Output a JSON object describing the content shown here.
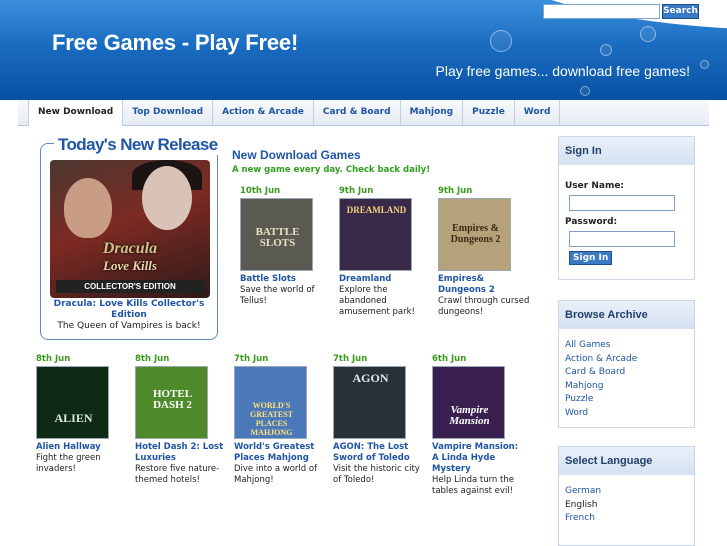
{
  "header": {
    "site_title": "Free Games - Play Free!",
    "tagline": "Play free games... download free games!",
    "search_placeholder": "",
    "search_button": "Search"
  },
  "nav": {
    "tabs": [
      {
        "label": "New Download",
        "active": true
      },
      {
        "label": "Top Download"
      },
      {
        "label": "Action & Arcade"
      },
      {
        "label": "Card & Board"
      },
      {
        "label": "Mahjong"
      },
      {
        "label": "Puzzle"
      },
      {
        "label": "Word"
      }
    ]
  },
  "release": {
    "heading": "Today's New Release",
    "art_line1": "Dracula",
    "art_line2": "Love Kills",
    "art_badge": "COLLECTOR'S EDITION",
    "title": "Dracula: Love Kills Collector's Edition",
    "description": "The Queen of Vampires is back!"
  },
  "section": {
    "title": "New Download Games",
    "subtitle": "A new game every day. Check back daily!"
  },
  "games": [
    {
      "date": "10th Jun",
      "name": "Battle Slots",
      "desc": "Save the world of Tellus!",
      "art": "BATTLE SLOTS",
      "bg": "#5b5a52"
    },
    {
      "date": "9th Jun",
      "name": "Dreamland",
      "desc": "Explore the abandoned amusement park!",
      "art": "DREAMLAND",
      "bg": "#3a2a4a"
    },
    {
      "date": "9th Jun",
      "name": "Empires& Dungeons 2",
      "desc": "Crawl through cursed dungeons!",
      "art": "Empires & Dungeons 2",
      "bg": "#b6a27a"
    },
    {
      "date": "8th Jun",
      "name": "Alien Hallway",
      "desc": "Fight the green invaders!",
      "art": "ALIEN",
      "bg": "#0f2a14"
    },
    {
      "date": "8th Jun",
      "name": "Hotel Dash 2: Lost Luxuries",
      "desc": "Restore five nature-themed hotels!",
      "art": "HOTEL DASH 2",
      "bg": "#4f8a2a"
    },
    {
      "date": "7th Jun",
      "name": "World's Greatest Places Mahjong",
      "desc": "Dive into a world of Mahjong!",
      "art": "WORLD'S GREATEST PLACES MAHJONG",
      "bg": "#4a78b8"
    },
    {
      "date": "7th Jun",
      "name": "AGON: The Lost Sword of Toledo",
      "desc": "Visit the historic city of Toledo!",
      "art": "AGON",
      "bg": "#2a3038"
    },
    {
      "date": "6th Jun",
      "name": "Vampire Mansion: A Linda Hyde Mystery",
      "desc": "Help Linda turn the tables against evil!",
      "art": "Vampire Mansion",
      "bg": "#3a2050"
    }
  ],
  "signin": {
    "title": "Sign In",
    "username_label": "User Name:",
    "password_label": "Password:",
    "button": "Sign In"
  },
  "archive": {
    "title": "Browse Archive",
    "links": [
      "All Games",
      "Action & Arcade",
      "Card & Board",
      "Mahjong",
      "Puzzle",
      "Word"
    ]
  },
  "language": {
    "title": "Select Language",
    "options": [
      {
        "label": "German",
        "link": true
      },
      {
        "label": "English",
        "link": false
      },
      {
        "label": "French",
        "link": true
      }
    ]
  },
  "colors": {
    "header_blue": "#1a6cc0",
    "link_blue": "#1f55a4",
    "date_green": "#3a9a1d"
  }
}
